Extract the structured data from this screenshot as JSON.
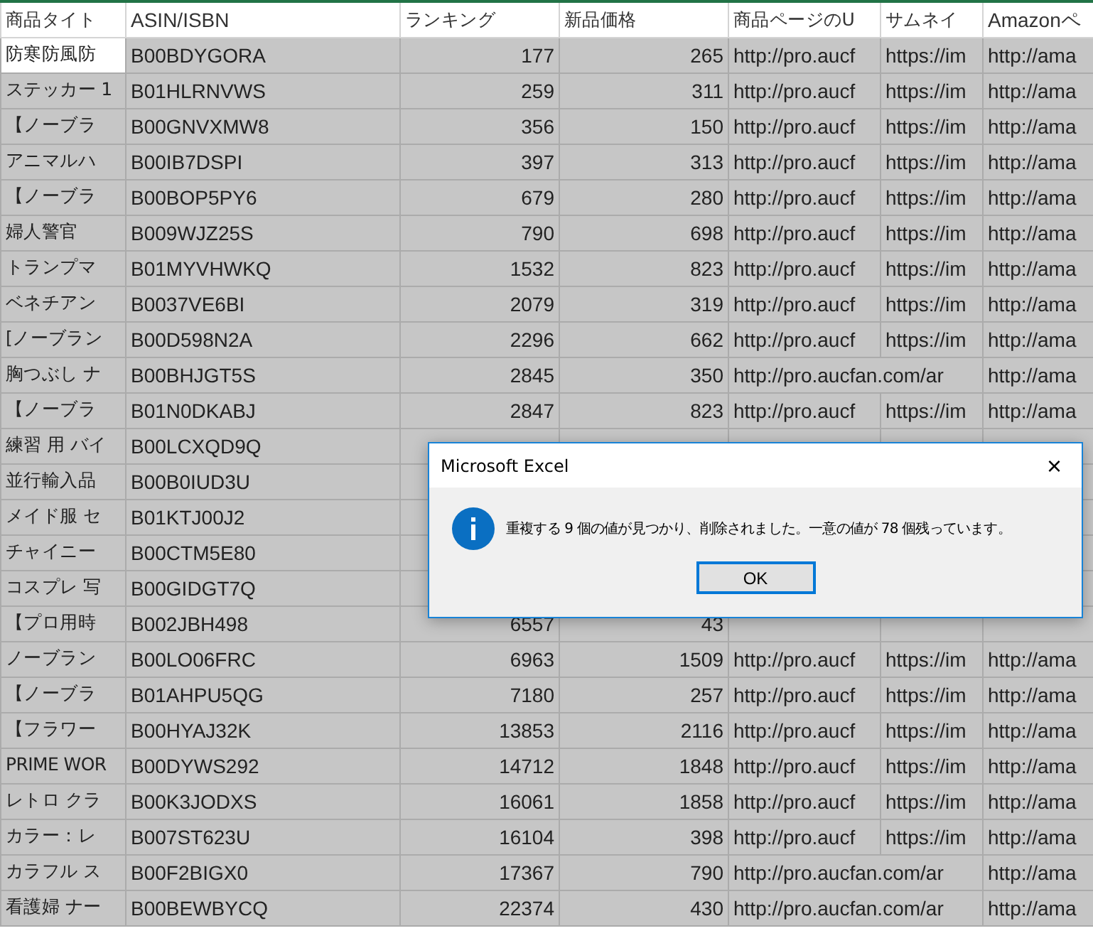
{
  "columns": [
    "商品タイト",
    "ASIN/ISBN",
    "ランキング",
    "新品価格",
    "商品ページのU",
    "サムネイ",
    "Amazonペ"
  ],
  "rows": [
    {
      "title": "防寒防風防",
      "asin": "B00BDYGORA",
      "ranking": "177",
      "price": "265",
      "page_url": "http://pro.aucf",
      "thumbnail": "https://im",
      "amazon": "http://ama",
      "selected": true,
      "active": true
    },
    {
      "title": "ステッカー 1",
      "asin": "B01HLRNVWS",
      "ranking": "259",
      "price": "311",
      "page_url": "http://pro.aucf",
      "thumbnail": "https://im",
      "amazon": "http://ama",
      "selected": true,
      "active": false
    },
    {
      "title": "【ノーブラ",
      "asin": "B00GNVXMW8",
      "ranking": "356",
      "price": "150",
      "page_url": "http://pro.aucf",
      "thumbnail": "https://im",
      "amazon": "http://ama",
      "selected": true,
      "active": false
    },
    {
      "title": "アニマルハ",
      "asin": "B00IB7DSPI",
      "ranking": "397",
      "price": "313",
      "page_url": "http://pro.aucf",
      "thumbnail": "https://im",
      "amazon": "http://ama",
      "selected": true,
      "active": false
    },
    {
      "title": "【ノーブラ",
      "asin": "B00BOP5PY6",
      "ranking": "679",
      "price": "280",
      "page_url": "http://pro.aucf",
      "thumbnail": "https://im",
      "amazon": "http://ama",
      "selected": true,
      "active": false
    },
    {
      "title": "婦人警官",
      "asin": "B009WJZ25S",
      "ranking": "790",
      "price": "698",
      "page_url": "http://pro.aucf",
      "thumbnail": "https://im",
      "amazon": "http://ama",
      "selected": true,
      "active": false
    },
    {
      "title": "トランプマ",
      "asin": "B01MYVHWKQ",
      "ranking": "1532",
      "price": "823",
      "page_url": "http://pro.aucf",
      "thumbnail": "https://im",
      "amazon": "http://ama",
      "selected": true,
      "active": false
    },
    {
      "title": "ベネチアン",
      "asin": "B0037VE6BI",
      "ranking": "2079",
      "price": "319",
      "page_url": "http://pro.aucf",
      "thumbnail": "https://im",
      "amazon": "http://ama",
      "selected": true,
      "active": false
    },
    {
      "title": "[ノーブラン",
      "asin": "B00D598N2A",
      "ranking": "2296",
      "price": "662",
      "page_url": "http://pro.aucf",
      "thumbnail": "https://im",
      "amazon": "http://ama",
      "selected": true,
      "active": false
    },
    {
      "title": "胸つぶし ナ",
      "asin": "B00BHJGT5S",
      "ranking": "2845",
      "price": "350",
      "page_url": "http://pro.aucfan.com/ar",
      "amazon": "http://ama",
      "selected": true,
      "active": false
    },
    {
      "title": "【ノーブラ",
      "asin": "B01N0DKABJ",
      "ranking": "2847",
      "price": "823",
      "page_url": "http://pro.aucf",
      "thumbnail": "https://im",
      "amazon": "http://ama",
      "selected": true,
      "active": false
    },
    {
      "title": "練習 用 バイ",
      "asin": "B00LCXQD9Q",
      "selected": true,
      "active": false
    },
    {
      "title": "並行輸入品",
      "asin": "B00B0IUD3U",
      "selected": true,
      "active": false
    },
    {
      "title": "メイド服 セ",
      "asin": "B01KTJ00J2",
      "selected": true,
      "active": false
    },
    {
      "title": "チャイニー",
      "asin": "B00CTM5E80",
      "selected": true,
      "active": false
    },
    {
      "title": "コスプレ 写",
      "asin": "B00GIDGT7Q",
      "selected": true,
      "active": false
    },
    {
      "title": "【プロ用時",
      "asin": "B002JBH498",
      "ranking": "6557",
      "price": "43",
      "selected": true,
      "active": false
    },
    {
      "title": "ノーブラン",
      "asin": "B00LO06FRC",
      "ranking": "6963",
      "price": "1509",
      "page_url": "http://pro.aucf",
      "thumbnail": "https://im",
      "amazon": "http://ama",
      "selected": true,
      "active": false
    },
    {
      "title": "【ノーブラ",
      "asin": "B01AHPU5QG",
      "ranking": "7180",
      "price": "257",
      "page_url": "http://pro.aucf",
      "thumbnail": "https://im",
      "amazon": "http://ama",
      "selected": true,
      "active": false
    },
    {
      "title": "【フラワー",
      "asin": "B00HYAJ32K",
      "ranking": "13853",
      "price": "2116",
      "page_url": "http://pro.aucf",
      "thumbnail": "https://im",
      "amazon": "http://ama",
      "selected": true,
      "active": false
    },
    {
      "title": "PRIME WOR",
      "asin": "B00DYWS292",
      "ranking": "14712",
      "price": "1848",
      "page_url": "http://pro.aucf",
      "thumbnail": "https://im",
      "amazon": "http://ama",
      "selected": true,
      "active": false
    },
    {
      "title": "レトロ クラ",
      "asin": "B00K3JODXS",
      "ranking": "16061",
      "price": "1858",
      "page_url": "http://pro.aucf",
      "thumbnail": "https://im",
      "amazon": "http://ama",
      "selected": true,
      "active": false
    },
    {
      "title": "カラー：レ",
      "asin": "B007ST623U",
      "ranking": "16104",
      "price": "398",
      "page_url": "http://pro.aucf",
      "thumbnail": "https://im",
      "amazon": "http://ama",
      "selected": true,
      "active": false
    },
    {
      "title": "カラフル ス",
      "asin": "B00F2BIGX0",
      "ranking": "17367",
      "price": "790",
      "page_url": "http://pro.aucfan.com/ar",
      "amazon": "http://ama",
      "selected": true,
      "active": false
    },
    {
      "title": "看護婦 ナー",
      "asin": "B00BEWBYCQ",
      "ranking": "22374",
      "price": "430",
      "page_url": "http://pro.aucfan.com/ar",
      "amazon": "http://ama",
      "selected": true,
      "active": false
    }
  ],
  "dialog": {
    "title": "Microsoft Excel",
    "close": "×",
    "message": "重複する 9 個の値が見つかり、削除されました。一意の値が 78 個残っています。",
    "button": "OK"
  }
}
